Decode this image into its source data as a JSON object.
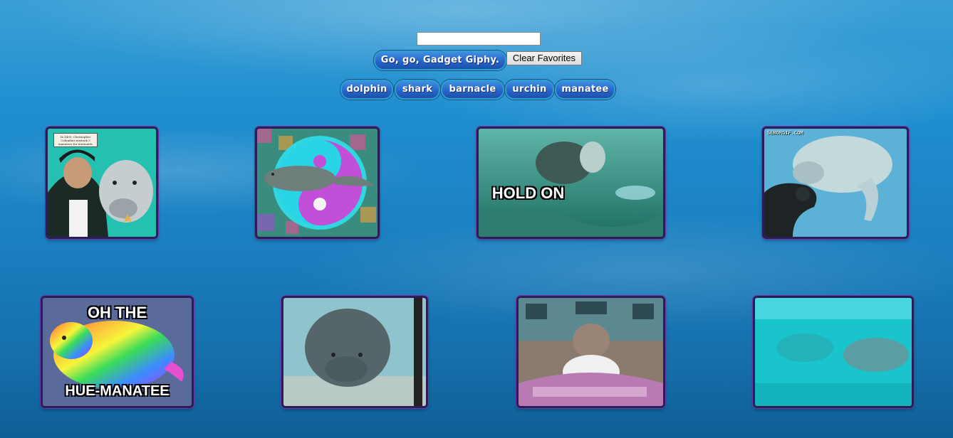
{
  "search": {
    "value": "",
    "placeholder": ""
  },
  "buttons": {
    "go_label": "Go, go, Gadget Giphy.",
    "clear_label": "Clear Favorites"
  },
  "topics": [
    "dolphin",
    "shark",
    "barnacle",
    "urchin",
    "manatee"
  ],
  "gifs": [
    {
      "caption": "In 1493, Christopher Columbus mistook 3 manatees for mermaids"
    },
    {
      "caption": ""
    },
    {
      "caption": "HOLD ON"
    },
    {
      "caption": "SENORGIF.COM"
    },
    {
      "caption_top": "OH THE",
      "caption_bottom": "HUE-MANATEE"
    },
    {
      "caption": ""
    },
    {
      "caption": ""
    },
    {
      "caption": ""
    }
  ],
  "colors": {
    "pill": "#2563c9",
    "frame": "#2b1d5a",
    "frame_glow": "#6a3aa8",
    "water": "#1a7fc0"
  }
}
